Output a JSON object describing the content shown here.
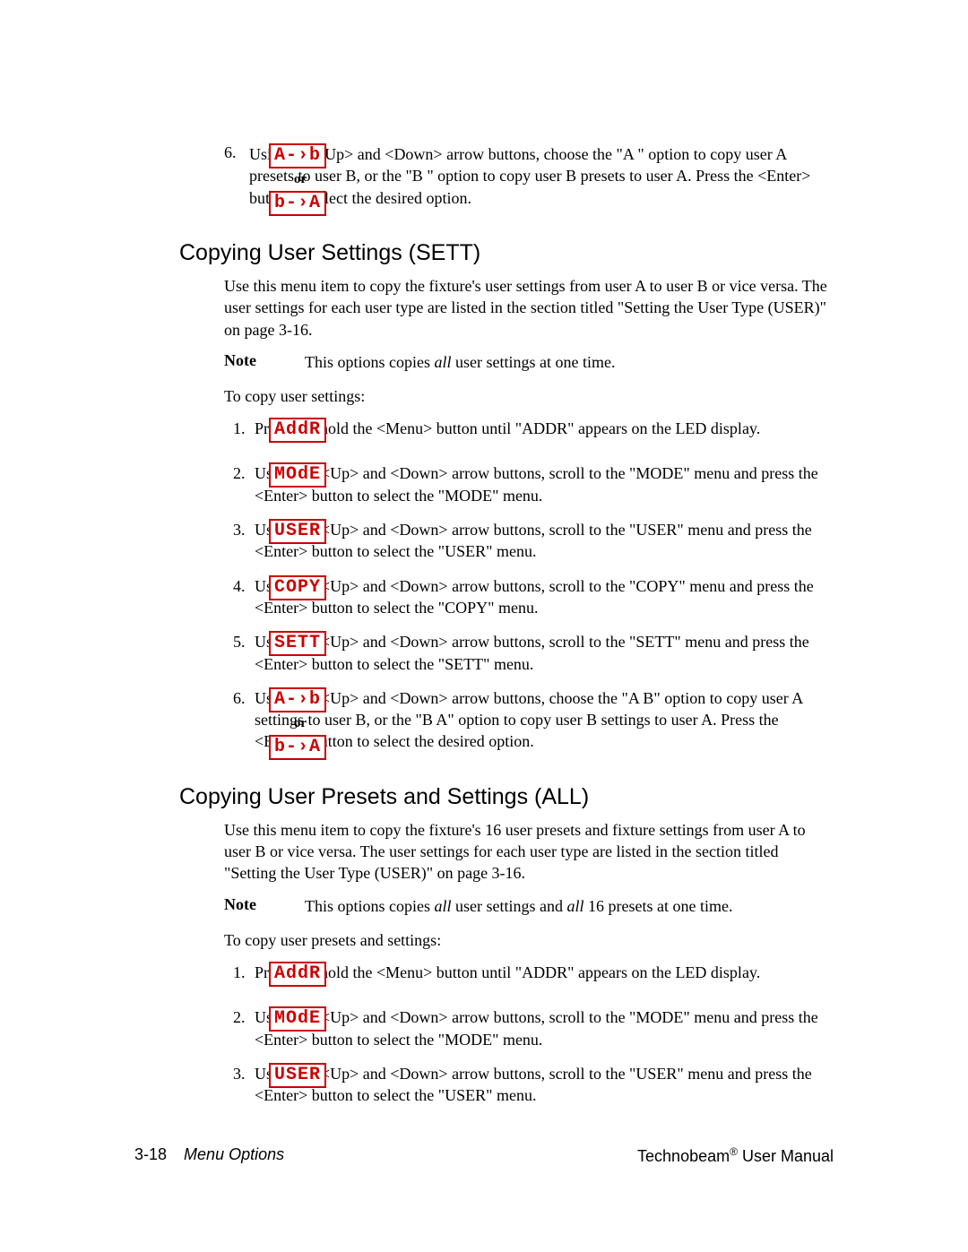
{
  "led": {
    "a_to_b": "A-›b",
    "b_to_a": "b-›A",
    "or": "or",
    "addr": "AddR",
    "mode": "MOdE",
    "user": "USER",
    "copy": "COPY",
    "sett": "SETT"
  },
  "top": {
    "step6_num": "6.",
    "step6_text": "Using the <Up> and <Down> arrow buttons, choose the \"A    \" option to copy user A presets to user B, or the \"B    \" option to copy user B presets to user A.   Press the <Enter> button to select the desired option."
  },
  "sett": {
    "heading": "Copying User Settings (SETT)",
    "intro": "Use this menu item to copy the fixture's user settings from user A to user B or vice versa.  The user settings for each user type are listed in the section titled \"Setting the User Type (USER)\" on page 3-16.",
    "note_label": "Note",
    "note_text_pre": "This options copies ",
    "note_text_ital": "all",
    "note_text_post": " user settings at one time.",
    "to_copy": "To copy user settings:",
    "steps": [
      "Press and hold the <Menu> button until \"ADDR\" appears on the LED display.",
      "Using the <Up> and <Down> arrow buttons, scroll to the \"MODE\" menu and press the <Enter> button to select the \"MODE\" menu.",
      "Using the <Up> and <Down> arrow buttons, scroll to the \"USER\" menu and press the <Enter> button to select the \"USER\" menu.",
      "Using the <Up> and <Down> arrow buttons, scroll to the \"COPY\" menu and press the <Enter> button to select the \"COPY\" menu.",
      "Using the <Up> and <Down> arrow buttons, scroll to the \"SETT\" menu and press the <Enter> button to select the \"SETT\" menu.",
      "Using the <Up> and <Down> arrow buttons, choose the \"A    B\" option to copy user A settings to user B, or the \"B    A\" option to copy user B settings to user A.   Press the <Enter> button to select the desired option."
    ]
  },
  "all": {
    "heading": "Copying User Presets and Settings (ALL)",
    "intro": "Use this menu item to copy the fixture's 16 user presets and fixture settings from user A to user B or vice versa.  The user settings for each user type are listed in the section titled \"Setting the User Type (USER)\" on page 3-16.",
    "note_label": "Note",
    "note_text_pre": "This options copies ",
    "note_text_ital1": "all",
    "note_text_mid": " user settings and ",
    "note_text_ital2": "all",
    "note_text_post": " 16 presets at one time.",
    "to_copy": "To copy user presets and settings:",
    "steps": [
      "Press and hold the <Menu> button until \"ADDR\" appears on the LED display.",
      "Using the <Up> and <Down> arrow buttons, scroll to the \"MODE\" menu and press the <Enter> button to select the \"MODE\" menu.",
      "Using the <Up> and <Down> arrow buttons, scroll to the \"USER\" menu and press the <Enter> button to select the \"USER\" menu."
    ]
  },
  "footer": {
    "pagenum": "3-18",
    "section": "Menu Options",
    "product": "Technobeam",
    "reg": "®",
    "manual": " User Manual"
  }
}
